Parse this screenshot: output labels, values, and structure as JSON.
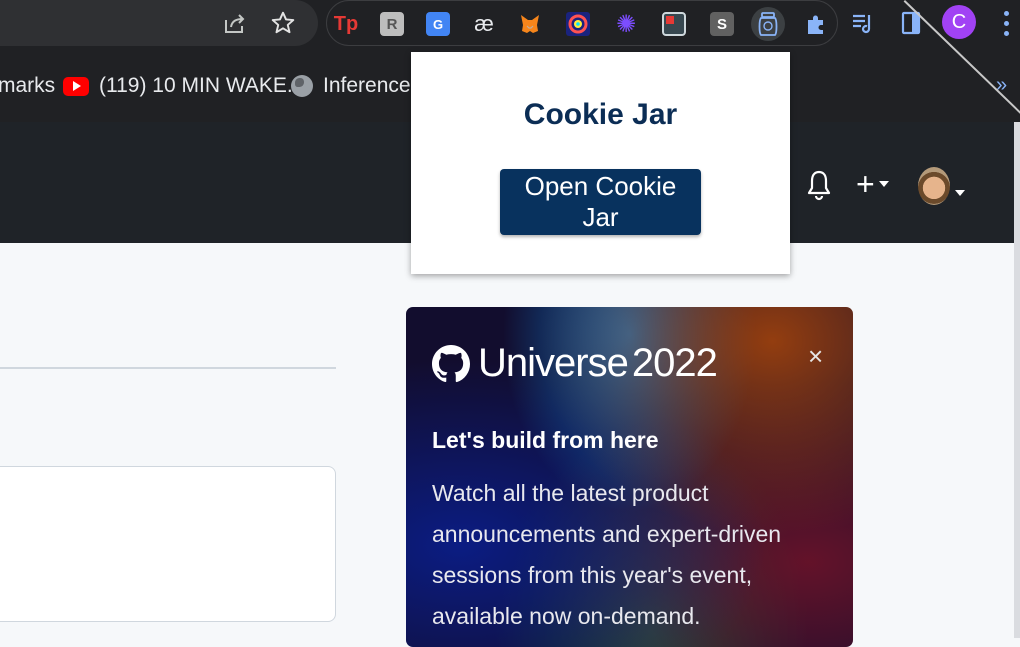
{
  "browser": {
    "toolbar": {
      "icons": [
        "share-icon",
        "bookmark-star-icon"
      ],
      "extensions": [
        {
          "name": "tp-extension",
          "label": "Tp",
          "color": "#e53935"
        },
        {
          "name": "rk-extension",
          "label": "R",
          "color": "#9e9e9e"
        },
        {
          "name": "google-translate-extension",
          "label": "G",
          "color": "#4285f4"
        },
        {
          "name": "ae-extension",
          "label": "æ",
          "color": "#202124"
        },
        {
          "name": "metamask-extension",
          "label": "",
          "color": "#f6851b"
        },
        {
          "name": "color-picker-extension",
          "label": "",
          "color": "#ffffff"
        },
        {
          "name": "sparkle-extension",
          "label": "✺",
          "color": "#7c4dff"
        },
        {
          "name": "notes-extension",
          "label": "",
          "color": "#c62828"
        },
        {
          "name": "s-extension",
          "label": "S",
          "color": "#616161"
        },
        {
          "name": "cookie-jar-extension",
          "label": "",
          "color": "#8ab4f8"
        },
        {
          "name": "extensions-puzzle",
          "label": "",
          "color": "#8ab4f8"
        }
      ],
      "profile_initial": "C"
    },
    "bookmarks": {
      "items": [
        {
          "label": "marks"
        },
        {
          "label": "(119) 10 MIN WAKE..."
        },
        {
          "label": "Inference P"
        }
      ],
      "overflow": "»"
    }
  },
  "popup": {
    "title": "Cookie Jar",
    "button_label": "Open Cookie Jar"
  },
  "github_header": {
    "plus": "+"
  },
  "universe_card": {
    "title": "Universe",
    "year": "2022",
    "close": "×",
    "subtitle": "Let's build from here",
    "body": "Watch all the latest product announcements and expert-driven sessions from this year's event, available now on-demand."
  }
}
